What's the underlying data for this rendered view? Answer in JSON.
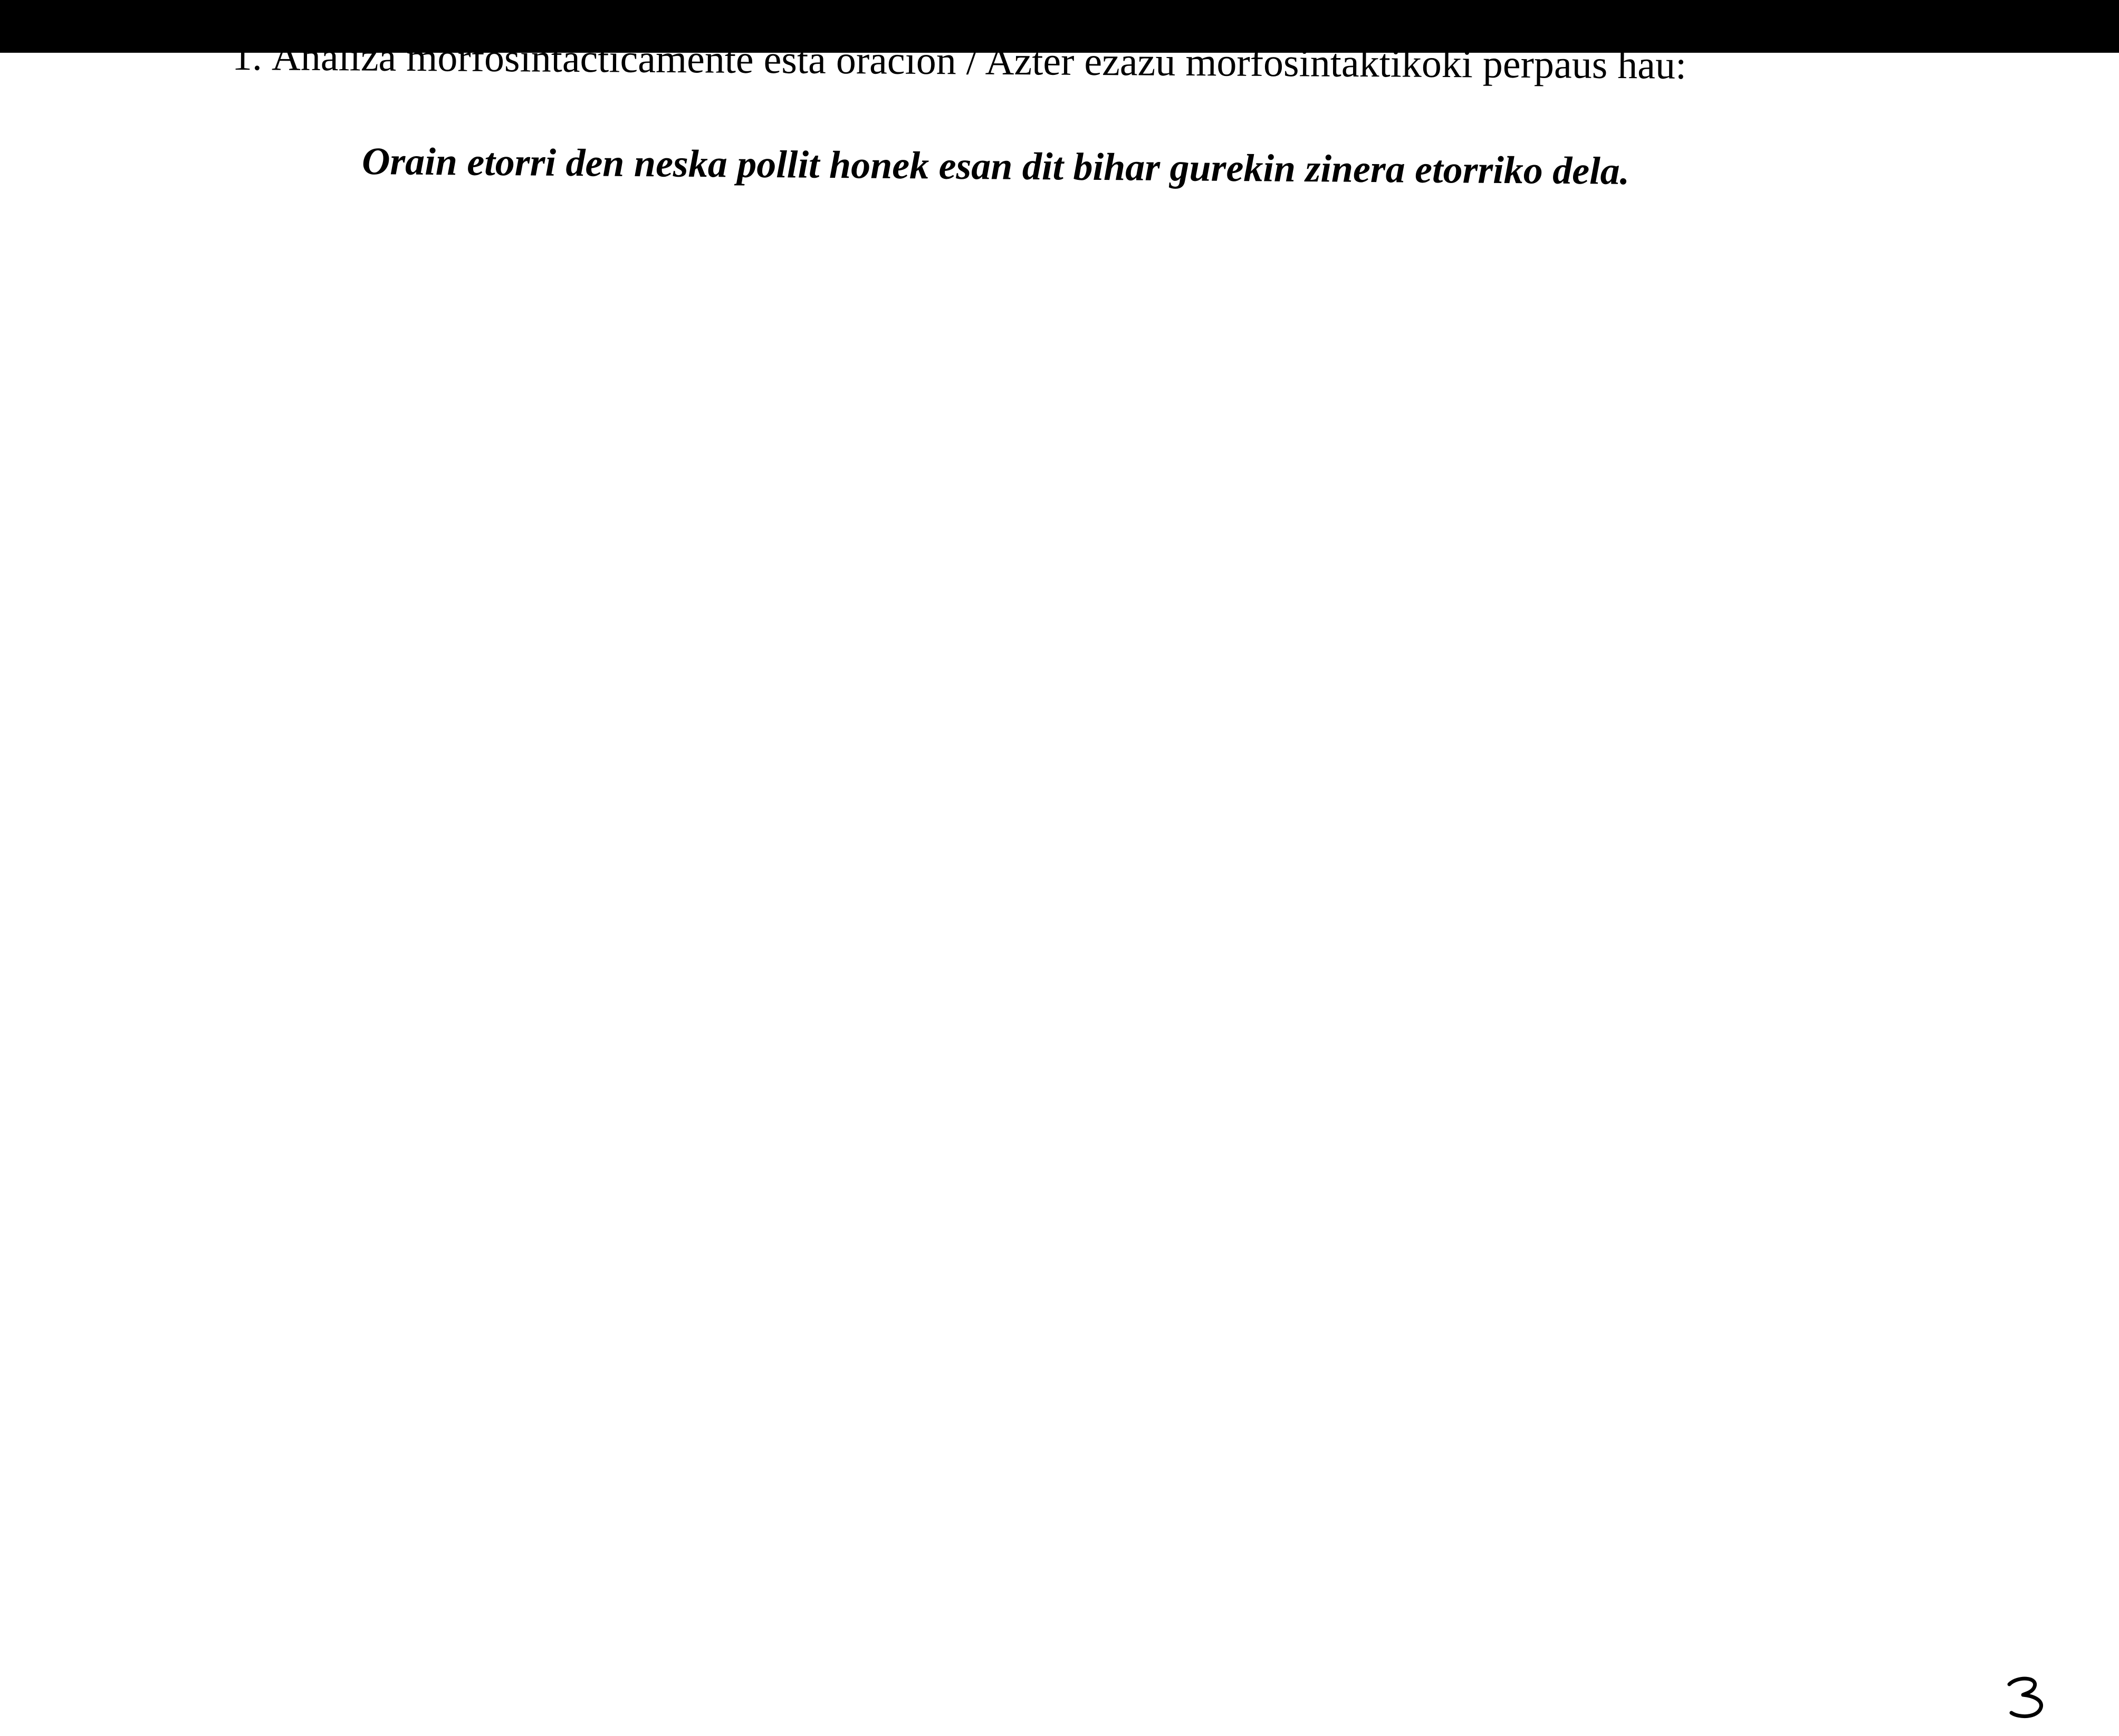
{
  "document": {
    "question": {
      "number": "1.",
      "text": "Analiza morfosintácticamente esta oración / Azter ezazu morfosintaktikoki perpaus hau:"
    },
    "sentence": "Orain etorri den neska pollit honek esan dit bihar gurekin zinera etorriko dela.",
    "page_number": "3"
  },
  "colors": {
    "background": "#ffffff",
    "text": "#000000",
    "top_bar": "#000000"
  }
}
